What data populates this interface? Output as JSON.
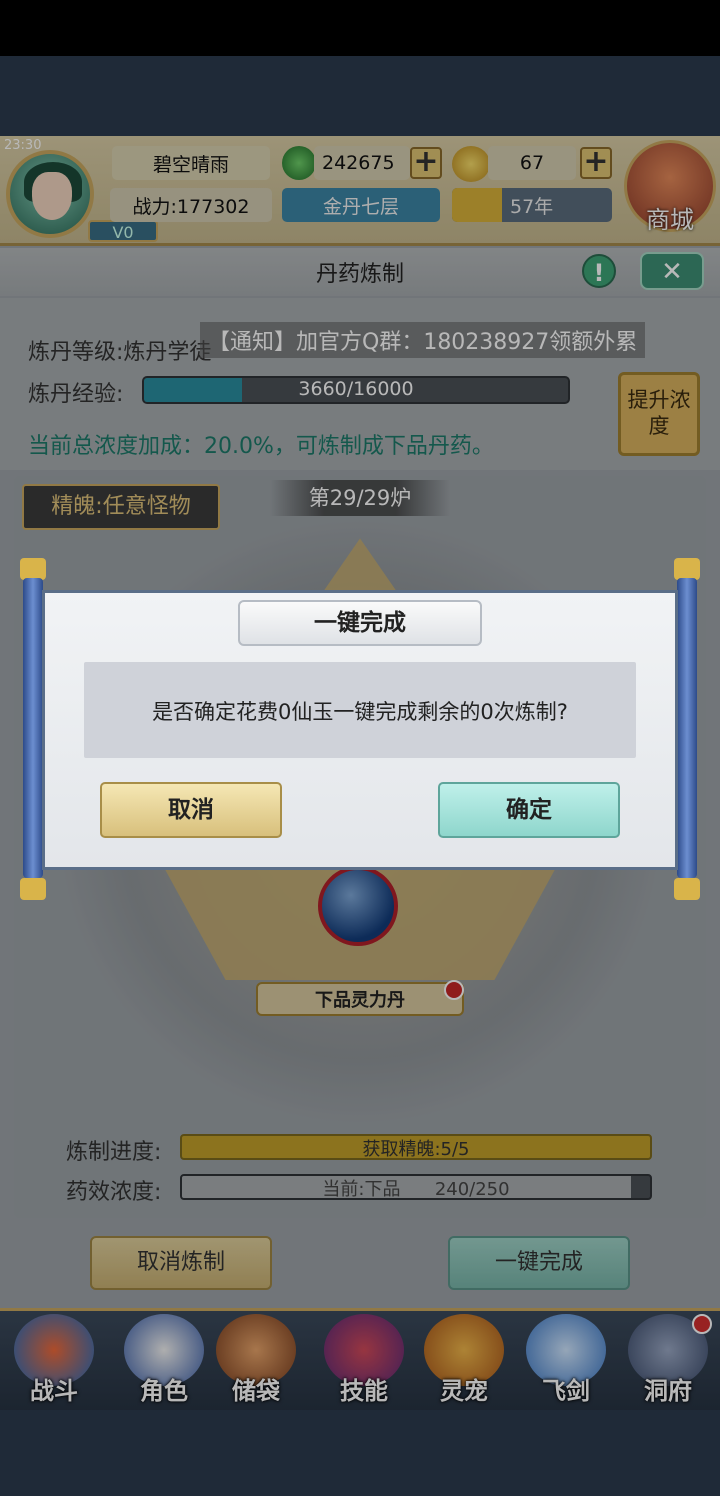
{
  "status": {
    "time": "23:30"
  },
  "hud": {
    "player_name": "碧空晴雨",
    "combat_power": "战力:177302",
    "vip": "V0",
    "jade": "242675",
    "gold": "67",
    "realm": "金丹七层",
    "years": "57年",
    "shop_label": "商城",
    "plus_symbol": "+"
  },
  "panel": {
    "title": "丹药炼制",
    "info_symbol": "!",
    "close_symbol": "✕"
  },
  "alchemy": {
    "level_label": "炼丹等级:炼丹学徒",
    "notice": "【通知】加官方Q群：180238927领额外累",
    "exp_label": "炼丹经验:",
    "exp_text": "3660/16000",
    "exp_progress": 0.23,
    "bonus_text": "当前总浓度加成：20.0%，可炼制成下品丹药。",
    "raise_button": "提升浓度"
  },
  "furnace": {
    "essence": "精魄:任意怪物",
    "count": "第29/29炉",
    "pill_name": "下品灵力丹",
    "progress_label": "炼制进度:",
    "progress_text": "获取精魄:5/5",
    "progress_value": 1.0,
    "concentration_label": "药效浓度:",
    "concentration_current": "当前:下品",
    "concentration_value": "240/250",
    "concentration_progress": 0.96,
    "cancel_button": "取消炼制",
    "complete_button": "一键完成"
  },
  "dialog": {
    "title": "一键完成",
    "message": "是否确定花费0仙玉一键完成剩余的0次炼制?",
    "cancel": "取消",
    "confirm": "确定"
  },
  "nav": [
    {
      "label": "战斗",
      "icon": "battle-icon"
    },
    {
      "label": "角色",
      "icon": "character-icon"
    },
    {
      "label": "储袋",
      "icon": "bag-icon"
    },
    {
      "label": "技能",
      "icon": "skill-icon"
    },
    {
      "label": "灵宠",
      "icon": "pet-icon"
    },
    {
      "label": "飞剑",
      "icon": "flying-sword-icon"
    },
    {
      "label": "洞府",
      "icon": "cave-icon"
    }
  ],
  "colors": {
    "accent_teal": "#3d8f75",
    "gold_frame": "#c9a860",
    "notice_red": "#c62828"
  }
}
